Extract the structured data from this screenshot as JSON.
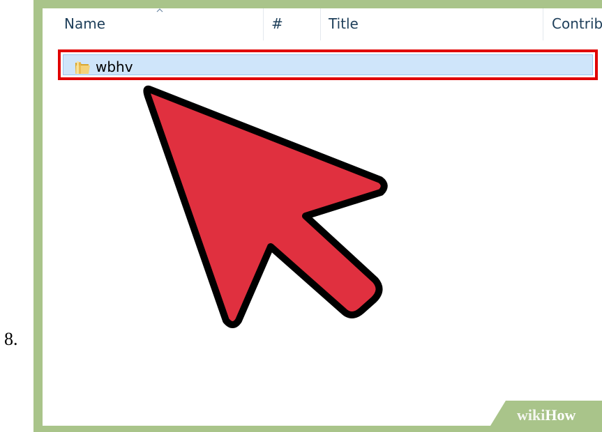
{
  "step": {
    "number": "8."
  },
  "list_header": {
    "columns": [
      {
        "label": "Name"
      },
      {
        "label": "#"
      },
      {
        "label": "Title"
      },
      {
        "label": "Contrib"
      }
    ]
  },
  "rows": [
    {
      "name": "wbhv",
      "icon": "folder-icon",
      "selected": true
    }
  ],
  "highlight": {
    "border_color": "#e00000",
    "selection_color": "#cfe5fa"
  },
  "cursor": {
    "icon": "arrow-pointer-icon",
    "fill_color": "#e0303f",
    "stroke_color": "#000000"
  },
  "watermark": {
    "part1": "wiki",
    "part2": "How"
  },
  "colors": {
    "frame": "#a9c48a",
    "header_text": "#1e3f5a"
  }
}
